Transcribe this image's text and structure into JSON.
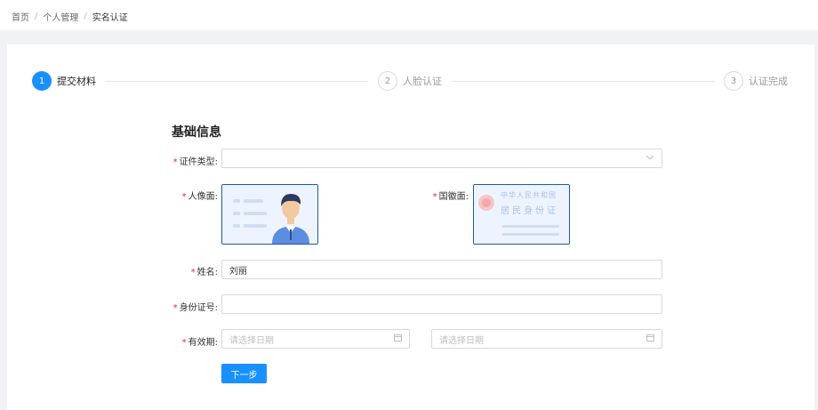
{
  "breadcrumb": {
    "items": [
      "首页",
      "个人管理",
      "实名认证"
    ],
    "separator": "/"
  },
  "steps": [
    {
      "number": "1",
      "label": "提交材料",
      "state": "active"
    },
    {
      "number": "2",
      "label": "人脸认证",
      "state": "inactive"
    },
    {
      "number": "3",
      "label": "认证完成",
      "state": "inactive"
    }
  ],
  "form": {
    "section_title": "基础信息",
    "required_mark": "*",
    "doc_type": {
      "label": "证件类型:",
      "value": "",
      "icon": "chevron-down-icon"
    },
    "portrait_side": {
      "label": "人像面:"
    },
    "emblem_side": {
      "label": "国徽面:",
      "card_line1": "中华人民共和国",
      "card_line2": "居民身份证"
    },
    "name": {
      "label": "姓名:",
      "value": "刘丽"
    },
    "id_number": {
      "label": "身份证号:",
      "value": ""
    },
    "validity": {
      "label": "有效期:",
      "start_placeholder": "请选择日期",
      "end_placeholder": "请选择日期",
      "icon": "calendar-icon"
    },
    "next_label": "下一步"
  },
  "colors": {
    "primary": "#1890ff",
    "required": "#f5222d",
    "upload_border": "#1e5aa8"
  }
}
